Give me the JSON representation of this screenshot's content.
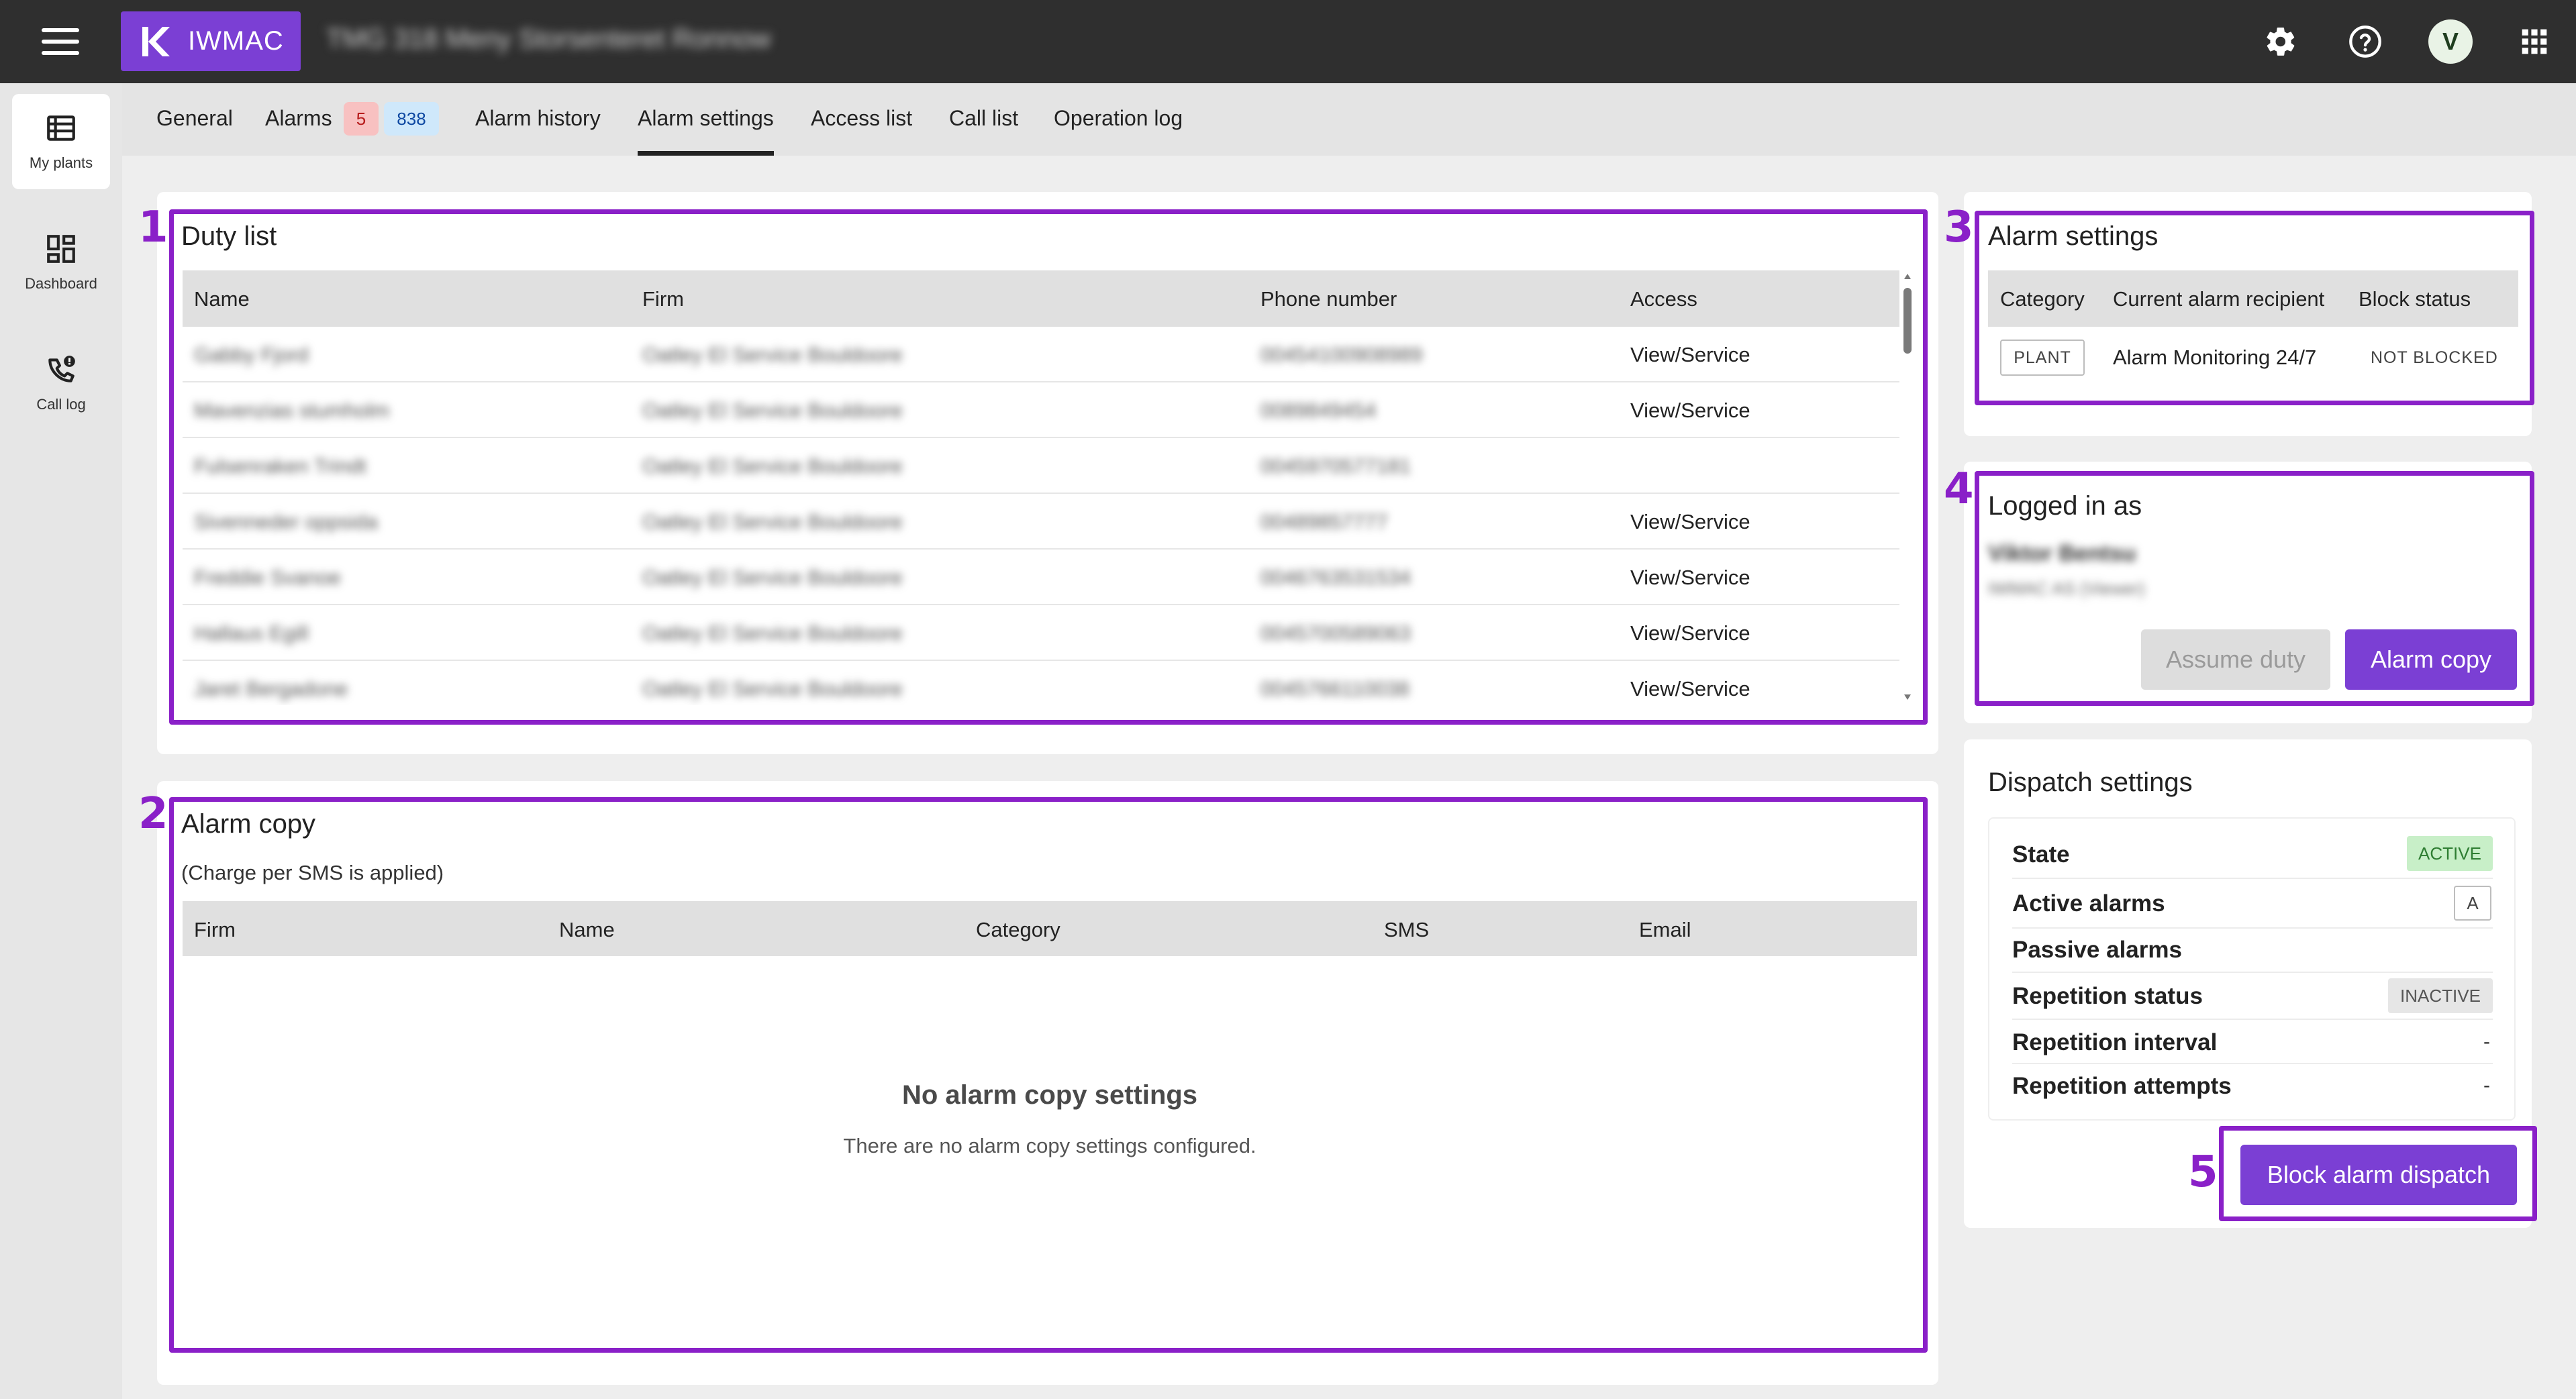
{
  "app": {
    "brand": "IWMAC",
    "plant_title": "TMG 318 Meny Storsenteret Ronnow"
  },
  "header": {
    "icons": [
      "gear-icon",
      "help-icon",
      "apps-grid-icon"
    ],
    "avatar_initial": "V"
  },
  "sidebar": {
    "items": [
      {
        "label": "My plants",
        "icon": "plants-list-icon"
      },
      {
        "label": "Dashboard",
        "icon": "dashboard-icon"
      },
      {
        "label": "Call log",
        "icon": "phone-alert-icon"
      }
    ]
  },
  "tabs": {
    "items": [
      {
        "label": "General"
      },
      {
        "label": "Alarms"
      },
      {
        "label": "Alarm history"
      },
      {
        "label": "Alarm settings"
      },
      {
        "label": "Access list"
      },
      {
        "label": "Call list"
      },
      {
        "label": "Operation log"
      }
    ],
    "active": "Alarm settings",
    "alarm_badges": {
      "active": "5",
      "total": "838"
    }
  },
  "annotations": [
    "1",
    "2",
    "3",
    "4",
    "5"
  ],
  "duty_list": {
    "title": "Duty list",
    "columns": [
      "Name",
      "Firm",
      "Phone number",
      "Access"
    ],
    "rows": [
      {
        "name": "Gabby Fjord",
        "firm": "Oatley El Service Bouldoore",
        "phone": "00454100908989",
        "access": "View/Service"
      },
      {
        "name": "Mavenzias stumholm",
        "firm": "Oatley El Service Bouldoore",
        "phone": "0089849454",
        "access": "View/Service"
      },
      {
        "name": "Fulsenraken Trindt",
        "firm": "Oatley El Service Bouldoore",
        "phone": "0045970577181",
        "access": ""
      },
      {
        "name": "Sivenneder oppsida",
        "firm": "Oatley El Service Bouldoore",
        "phone": "00489857777",
        "access": "View/Service"
      },
      {
        "name": "Freddie Svanoe",
        "firm": "Oatley El Service Bouldoore",
        "phone": "0046763531534",
        "access": "View/Service"
      },
      {
        "name": "Hallaus Egill",
        "firm": "Oatley El Service Bouldoore",
        "phone": "0045700589063",
        "access": "View/Service"
      },
      {
        "name": "Jaret Bergadone",
        "firm": "Oatley El Service Bouldoore",
        "phone": "0045766110038",
        "access": "View/Service"
      }
    ]
  },
  "alarm_copy": {
    "title": "Alarm copy",
    "subtitle": "(Charge per SMS is applied)",
    "columns": [
      "Firm",
      "Name",
      "Category",
      "SMS",
      "Email"
    ],
    "empty_title": "No alarm copy settings",
    "empty_text": "There are no alarm copy settings configured."
  },
  "alarm_settings": {
    "title": "Alarm settings",
    "columns": [
      "Category",
      "Current alarm recipient",
      "Block status"
    ],
    "row": {
      "category": "PLANT",
      "recipient": "Alarm Monitoring 24/7",
      "block_status": "NOT BLOCKED"
    }
  },
  "logged_in": {
    "title": "Logged in as",
    "user_name": "Viktor Bentsu",
    "user_detail": "IWMAC AS (Viewer)",
    "assume_duty_label": "Assume duty",
    "alarm_copy_label": "Alarm copy"
  },
  "dispatch": {
    "title": "Dispatch settings",
    "rows": [
      {
        "label": "State",
        "value": "ACTIVE"
      },
      {
        "label": "Active alarms",
        "value": "A"
      },
      {
        "label": "Passive alarms",
        "value": ""
      },
      {
        "label": "Repetition status",
        "value": "INACTIVE"
      },
      {
        "label": "Repetition interval",
        "value": "-"
      },
      {
        "label": "Repetition attempts",
        "value": "-"
      }
    ],
    "block_button_label": "Block alarm dispatch"
  },
  "colors": {
    "brand": "#7b3fd4",
    "annotation": "#8a20c8",
    "topbar": "#2f2f2f",
    "active_chip_bg": "#c8efc8",
    "alarm_badge_bg": "#f8c1c1",
    "count_badge_bg": "#cfe8fb"
  }
}
